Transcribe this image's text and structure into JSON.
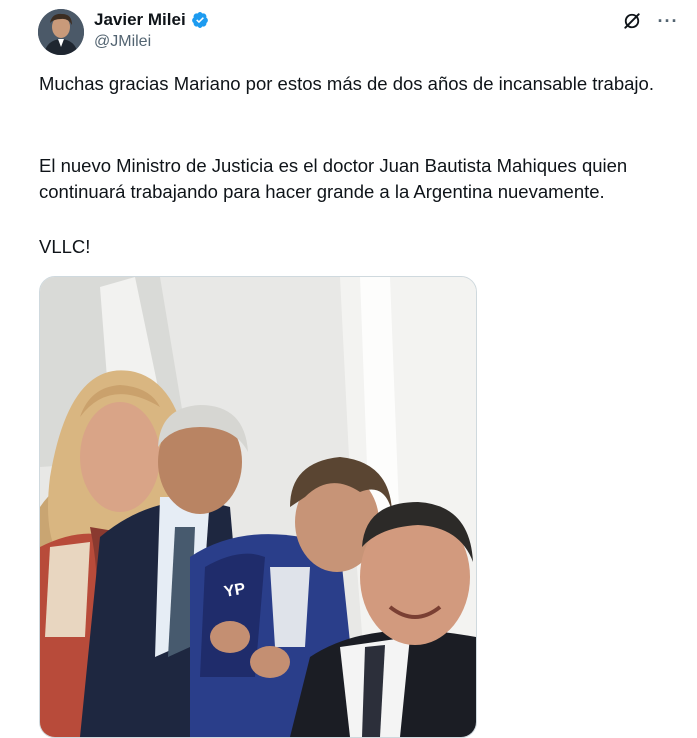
{
  "author": {
    "display_name": "Javier Milei",
    "handle": "@JMilei",
    "verified": true
  },
  "icons": {
    "verified": "verified-badge-icon",
    "grok": "grok-icon",
    "more": "more-options-icon"
  },
  "more_label": "···",
  "tweet": {
    "paragraph_1": "Muchas gracias Mariano por estos más de dos años de incansable trabajo.",
    "paragraph_2": "El nuevo Ministro de Justicia es el doctor Juan Bautista Mahiques quien continuará trabajando para hacer grande a la Argentina nuevamente.",
    "paragraph_3": "VLLC!"
  },
  "media": {
    "jacket_text": "YP"
  },
  "colors": {
    "verified_blue": "#1d9bf0",
    "text_primary": "#0f1419",
    "text_secondary": "#536471",
    "border": "#cfd9de"
  }
}
